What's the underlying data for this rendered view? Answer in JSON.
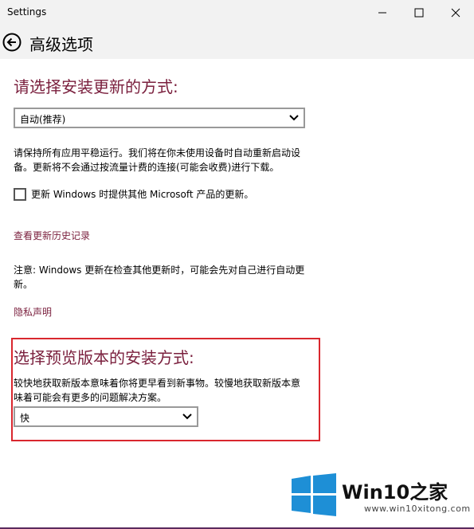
{
  "window": {
    "title": "Settings"
  },
  "header": {
    "page_title": "高级选项"
  },
  "update_section": {
    "heading": "请选择安装更新的方式:",
    "selected_option": "自动(推荐)",
    "desc_line1": "请保持所有应用平稳运行。我们将在你未使用设备时自动重新启动设",
    "desc_line2": "备。更新将不会通过按流量计费的连接(可能会收费)进行下载。",
    "checkbox_label": "更新 Windows 时提供其他 Microsoft 产品的更新。",
    "checkbox_checked": false,
    "history_link": "查看更新历史记录",
    "note_line1": "注意: Windows 更新在检查其他更新时，可能会先对自己进行自动更",
    "note_line2": "新。",
    "privacy_link": "隐私声明"
  },
  "preview_section": {
    "heading": "选择预览版本的安装方式:",
    "desc_line1": "较快地获取新版本意味着你将更早看到新事物。较慢地获取新版本意",
    "desc_line2": "味着可能会有更多的问题解决方案。",
    "selected_option": "快"
  },
  "watermark": {
    "brand_a": "Win10",
    "brand_b": "之家",
    "url": "www.win10xitong.com"
  },
  "colors": {
    "accent": "#7a1f3d",
    "highlight_border": "#d9272e",
    "logo_blue": "#1e8fd6"
  }
}
